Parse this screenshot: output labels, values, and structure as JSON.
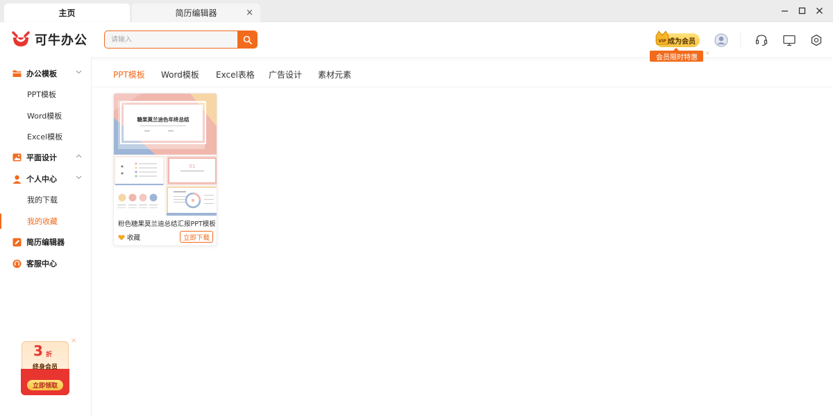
{
  "colors": {
    "accent": "#f26b1d",
    "promo_red": "#e8352f",
    "vip_gold": "#f6c343"
  },
  "tabs": [
    {
      "label": "主页",
      "active": true
    },
    {
      "label": "简历编辑器",
      "active": false,
      "close": "×"
    }
  ],
  "window_controls": {
    "minimize": "—",
    "maximize": "☐",
    "close": "✕"
  },
  "header": {
    "logo_text": "可牛办公",
    "search": {
      "placeholder": "请输入",
      "value": ""
    },
    "vip": {
      "badge": "VIP",
      "label": "成为会员",
      "promo": "会员限时特惠",
      "promo_close": "×"
    },
    "icons": [
      "avatar-icon",
      "headset-icon",
      "monitor-icon",
      "settings-icon"
    ]
  },
  "sidebar": {
    "groups": [
      {
        "label": "办公模板",
        "icon": "folder-icon",
        "expanded": true,
        "items": [
          {
            "label": "PPT模板"
          },
          {
            "label": "Word模板"
          },
          {
            "label": "Excel模板"
          }
        ]
      },
      {
        "label": "平面设计",
        "icon": "image-icon",
        "expanded": false,
        "items": []
      },
      {
        "label": "个人中心",
        "icon": "user-icon",
        "expanded": true,
        "items": [
          {
            "label": "我的下载"
          },
          {
            "label": "我的收藏",
            "active": true
          }
        ]
      },
      {
        "label": "简历编辑器",
        "icon": "edit-icon",
        "items": []
      },
      {
        "label": "客服中心",
        "icon": "support-icon",
        "items": []
      }
    ],
    "promo": {
      "number": "3",
      "unit": "折",
      "title": "终身会员",
      "cta": "立即领取",
      "close": "×"
    }
  },
  "content_tabs": [
    {
      "label": "PPT模板",
      "active": true
    },
    {
      "label": "Word模板"
    },
    {
      "label": "Excel表格"
    },
    {
      "label": "广告设计"
    },
    {
      "label": "素材元素"
    }
  ],
  "cards": [
    {
      "thumb_title": "糖果莫兰迪色年终总结",
      "thumb_section": "01",
      "title": "粉色糖果莫兰迪总结汇报PPT模板",
      "fav_label": "收藏",
      "download_label": "立即下载"
    }
  ]
}
